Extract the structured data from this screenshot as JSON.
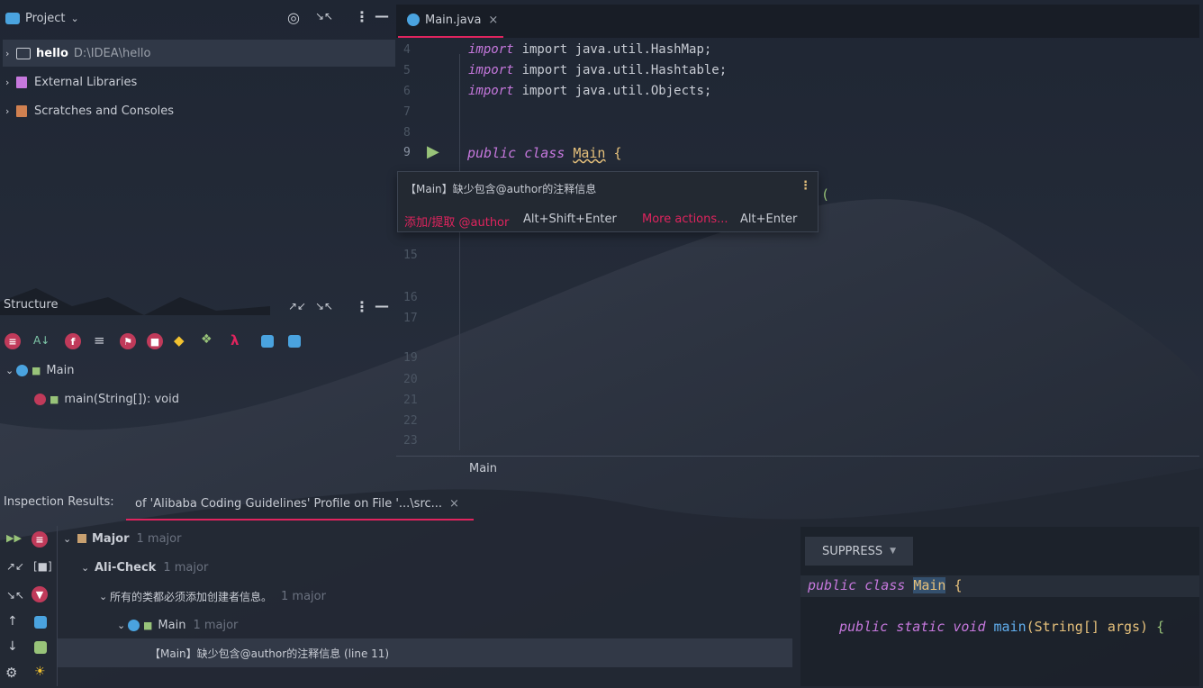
{
  "project_panel": {
    "title": "Project",
    "tree": [
      {
        "name": "hello",
        "path": "D:\\IDEA\\hello"
      },
      {
        "name": "External Libraries"
      },
      {
        "name": "Scratches and Consoles"
      }
    ]
  },
  "editor": {
    "tab_label": "Main.java",
    "tab_close": "×",
    "lines": [
      {
        "num": "4",
        "text": "import java.util.HashMap;"
      },
      {
        "num": "5",
        "text": "import java.util.Hashtable;"
      },
      {
        "num": "6",
        "text": "import java.util.Objects;"
      },
      {
        "num": "7",
        "text": ""
      },
      {
        "num": "8",
        "text": ""
      },
      {
        "num": "9",
        "text": "public class Main {"
      }
    ],
    "tail_line_nums": [
      "15",
      "16",
      "17",
      "19",
      "20",
      "21",
      "22",
      "23"
    ],
    "breadcrumb": "Main",
    "code": {
      "kw_public": "public",
      "kw_class": "class",
      "class_name": "Main",
      "brace": "{",
      "kw_import": "import",
      "paren": "("
    }
  },
  "popup": {
    "message": "【Main】缺少包含@author的注释信息",
    "action1": "添加/提取 @author",
    "shortcut1": "Alt+Shift+Enter",
    "action2": "More actions...",
    "shortcut2": "Alt+Enter"
  },
  "structure_panel": {
    "title": "Structure",
    "items": [
      {
        "label": "Main"
      },
      {
        "label": "main(String[]): void"
      }
    ]
  },
  "inspection": {
    "title": "Inspection Results:",
    "tab_label": "of 'Alibaba Coding Guidelines' Profile on File '...\\src...",
    "tab_close": "×",
    "tree": [
      {
        "label": "Major",
        "count": "1 major"
      },
      {
        "label": "Ali-Check",
        "count": "1 major"
      },
      {
        "label": "所有的类都必须添加创建者信息。",
        "count": "1 major"
      },
      {
        "label": "Main",
        "count": "1 major"
      },
      {
        "label": "【Main】缺少包含@author的注释信息 (line 11)"
      }
    ],
    "suppress_label": "SUPPRESS",
    "preview": {
      "line1": {
        "kw_public": "public",
        "kw_class": "class",
        "class_name": "Main",
        "brace": "{"
      },
      "line2": {
        "kw_public": "public",
        "kw_static": "static",
        "kw_void": "void",
        "method": "main",
        "params": "(String[] args)",
        "brace": "{"
      }
    }
  },
  "colors": {
    "accent": "#e0245e",
    "keyword": "#c678dd",
    "class": "#e5c07b",
    "run": "#98c379"
  }
}
